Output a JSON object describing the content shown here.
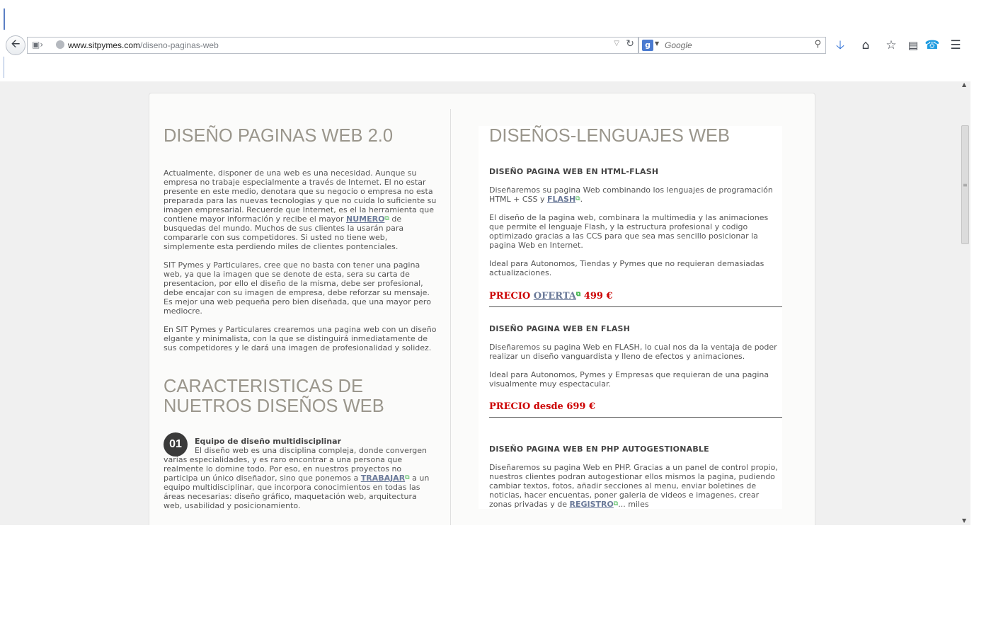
{
  "browser": {
    "url_domain": "www.sitpymes.com",
    "url_path": "/diseno-paginas-web",
    "search_placeholder": "Google",
    "search_engine_letter": "g"
  },
  "left": {
    "title": "DISEÑO PAGINAS WEB 2.0",
    "p1_a": "Actualmente, disponer de una web es una necesidad. Aunque su empresa no trabaje especialmente a través de Internet. El no estar presente en este medio, denotara que su negocio o empresa no esta preparada para las nuevas tecnologias y que no cuida lo suficiente su imagen empresarial. Recuerde que Internet, es el la herramienta que contiene mayor información y recibe el mayor",
    "p1_link": "NUMERO",
    "p1_b": " de busquedas del mundo. Muchos de sus clientes la usarán para compararle con sus competidores. Si usted no tiene web, simplemente esta perdiendo miles de clientes pontenciales.",
    "p2": "SIT Pymes y Particulares, cree que no basta con tener una pagina web, ya que la imagen que se denote de esta, sera su carta de presentacion, por ello el diseño de la misma, debe ser profesional, debe encajar con su imagen de empresa, debe reforzar su mensaje. Es mejor una web pequeña pero bien diseñada, que una mayor pero mediocre.",
    "p3": "En SIT Pymes y Particulares crearemos una pagina web con un diseño elgante y minimalista, con la que se distinguirá inmediatamente de sus competidores y le dará una imagen de profesionalidad y solidez.",
    "title2_line1": "CARACTERISTICAS DE",
    "title2_line2": "NUETROS DISEÑOS WEB",
    "feature": {
      "number": "01",
      "title": "Equipo de diseño multidisciplinar",
      "text_a": "El diseño web es una disciplina compleja, donde convergen varias especialidades, y es raro encontrar a una persona que realmente lo domine todo. Por eso, en nuestros proyectos no participa un único diseñador, sino que ponemos a",
      "link": "TRABAJAR",
      "text_b": " a un equipo multidisciplinar, que incorpora conocimientos en todas las áreas necesarias: diseño gráfico, maquetación web, arquitectura web, usabilidad y posicionamiento."
    }
  },
  "right": {
    "title": "DISEÑOS-LENGUAJES WEB",
    "s1": {
      "heading": "DISEÑO PAGINA WEB EN HTML-FLASH",
      "p1_a": "Diseñaremos su pagina Web combinando los lenguajes de programación HTML + CSS y",
      "p1_link": "FLASH",
      "p1_b": ".",
      "p2": "El diseño de la pagina web, combinara la multimedia y las animaciones que permite el lenguaje Flash, y la estructura profesional y codigo optimizado gracias a las CCS para que sea mas sencillo posicionar la pagina Web en Internet.",
      "p3": "Ideal para Autonomos, Tiendas y Pymes que no requieran demasiadas actualizaciones.",
      "price_a": "PRECIO",
      "price_link": "OFERTA",
      "price_b": " 499 €"
    },
    "s2": {
      "heading": "DISEÑO PAGINA WEB EN FLASH",
      "p1": "Diseñaremos su pagina Web en FLASH, lo cual nos da la ventaja de poder realizar un diseño vanguardista y lleno de efectos y animaciones.",
      "p2": "Ideal para Autonomos, Pymes y Empresas que requieran de una pagina visualmente muy espectacular.",
      "price": "PRECIO desde 699 €"
    },
    "s3": {
      "heading": "DISEÑO PAGINA WEB EN PHP AUTOGESTIONABLE",
      "p1_a": "Diseñaremos su pagina Web en PHP. Gracias a un panel de control propio, nuestros clientes podran autogestionar ellos mismos la pagina, pudiendo cambiar textos, fotos, añadir secciones al menu, enviar boletines de noticias, hacer encuentas, poner galeria de videos e imagenes, crear zonas privadas y de",
      "p1_link": "REGISTRO",
      "p1_b": "... miles"
    }
  },
  "icons": {
    "external": "external-link-icon",
    "back": "back-arrow-icon",
    "download": "download-icon",
    "home": "home-icon",
    "bookmark": "bookmark-star-icon",
    "reading_list": "reading-list-icon",
    "skype": "skype-icon",
    "menu": "hamburger-menu-icon"
  },
  "colors": {
    "heading": "#9a968c",
    "price": "#cc0000",
    "link": "#6b7a99",
    "external_icon": "#3cb34a"
  }
}
